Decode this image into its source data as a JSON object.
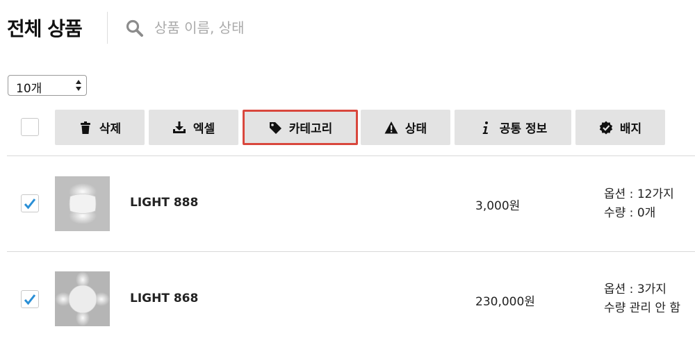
{
  "header": {
    "title": "전체 상품",
    "search_placeholder": "상품 이름, 상태"
  },
  "page_size": {
    "selected": "10개"
  },
  "toolbar": [
    {
      "label": "삭제",
      "icon": "trash-icon"
    },
    {
      "label": "엑셀",
      "icon": "download-icon"
    },
    {
      "label": "카테고리",
      "icon": "tag-icon",
      "highlighted": true
    },
    {
      "label": "상태",
      "icon": "warning-icon"
    },
    {
      "label": "공통 정보",
      "icon": "info-icon"
    },
    {
      "label": "배지",
      "icon": "badge-check-icon"
    }
  ],
  "products": [
    {
      "name": "LIGHT 888",
      "price": "3,000원",
      "options": "옵션 : 12가지",
      "stock": "수량 : 0개",
      "checked": true
    },
    {
      "name": "LIGHT 868",
      "price": "230,000원",
      "options": "옵션 : 3가지",
      "stock": "수량 관리 안 함",
      "checked": true
    }
  ],
  "colors": {
    "highlight_border": "#d9473d",
    "checkmark": "#2a8fd6",
    "button_bg": "#e3e3e3"
  }
}
